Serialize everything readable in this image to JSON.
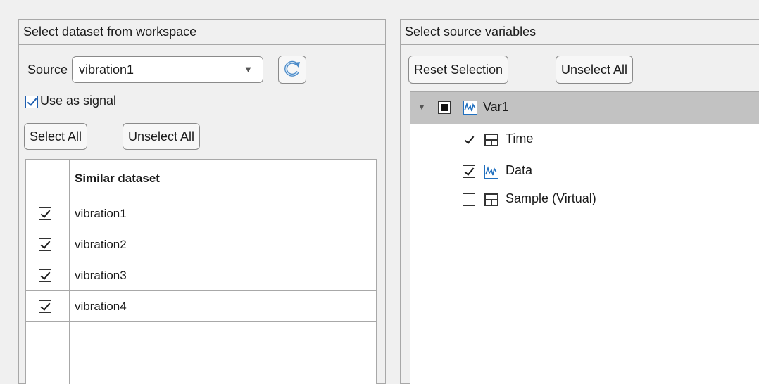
{
  "left_panel": {
    "title": "Select dataset from workspace",
    "source_label": "Source",
    "source_value": "vibration1",
    "use_as_signal_label": "Use as signal",
    "use_as_signal_checked": true,
    "select_all_label": "Select All",
    "unselect_all_label": "Unselect All",
    "table": {
      "header": "Similar dataset",
      "rows": [
        {
          "name": "vibration1",
          "checked": true
        },
        {
          "name": "vibration2",
          "checked": true
        },
        {
          "name": "vibration3",
          "checked": true
        },
        {
          "name": "vibration4",
          "checked": true
        }
      ]
    }
  },
  "right_panel": {
    "title": "Select source variables",
    "reset_selection_label": "Reset Selection",
    "unselect_all_label": "Unselect All",
    "tree": {
      "root": {
        "label": "Var1",
        "state": "partial",
        "expanded": true
      },
      "children": [
        {
          "label": "Time",
          "checked": true,
          "icon": "table-icon"
        },
        {
          "label": "Data",
          "checked": true,
          "icon": "signal-icon"
        },
        {
          "label": "Sample (Virtual)",
          "checked": false,
          "icon": "table-icon"
        }
      ]
    }
  },
  "colors": {
    "selected_row": "#c2c2c2",
    "accent": "#1f5fb0"
  }
}
